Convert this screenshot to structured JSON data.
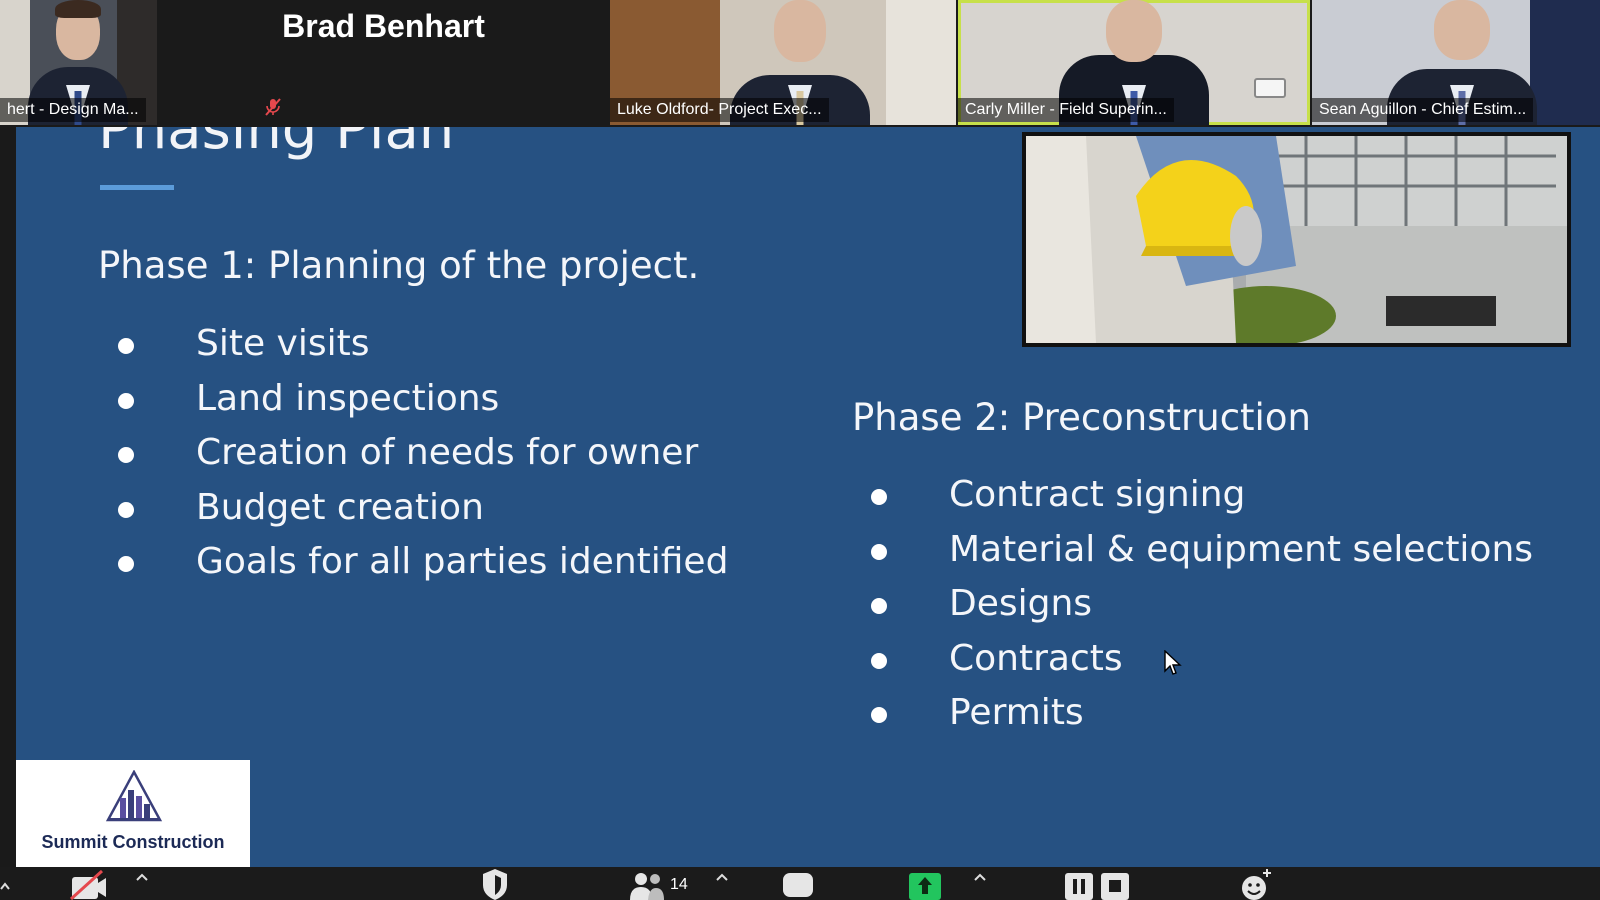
{
  "participants": {
    "tile1_name": "hert - Design Ma...",
    "featured_name": "Brad Benhart",
    "tile3_name": "Luke Oldford- Project Exec...",
    "tile4_name": "Carly Miller - Field Superin...",
    "tile5_name": "Sean Aguillon - Chief Estim..."
  },
  "slide": {
    "title": "Phasing Plan",
    "phase1": {
      "heading": "Phase 1: Planning of the project.",
      "items": [
        "Site visits",
        "Land inspections",
        "Creation of needs for owner",
        "Budget creation",
        "Goals for all parties identified"
      ]
    },
    "phase2": {
      "heading": "Phase 2: Preconstruction",
      "items": [
        "Contract signing",
        "Material & equipment selections",
        "Designs",
        "Contracts",
        "Permits"
      ]
    },
    "logo_text": "Summit Construction"
  },
  "toolbar": {
    "participant_count": "14"
  },
  "colors": {
    "slide_bg": "#265182",
    "accent_rule": "#5b9bd9",
    "speaking_border": "#c7e04a",
    "share_green": "#22c55e",
    "mute_red": "#e5484d"
  }
}
